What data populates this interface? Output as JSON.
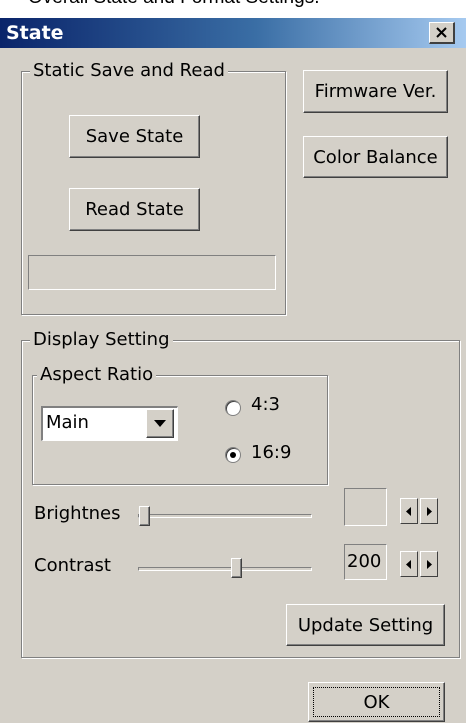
{
  "page_caption": "Overall State and Format Settings.",
  "window": {
    "title": "State"
  },
  "static_group": {
    "legend": "Static Save and Read",
    "save_button": "Save State",
    "read_button": "Read State",
    "status_text": ""
  },
  "side_buttons": {
    "firmware": "Firmware Ver.",
    "color_balance": "Color Balance"
  },
  "display_group": {
    "legend": "Display Setting",
    "aspect_group": {
      "legend": "Aspect Ratio",
      "select_value": "Main",
      "radio_options": [
        {
          "label": "4:3",
          "checked": false
        },
        {
          "label": "16:9",
          "checked": true
        }
      ]
    },
    "brightness": {
      "label": "Brightnes",
      "value_text": "",
      "level": 0.0
    },
    "contrast": {
      "label": "Contrast",
      "value_text": "200",
      "level": 0.58
    },
    "update_button": "Update Setting"
  },
  "ok_button": "OK",
  "icons": [
    "close-icon",
    "dropdown-arrow-icon",
    "spin-left-icon",
    "spin-right-icon"
  ]
}
